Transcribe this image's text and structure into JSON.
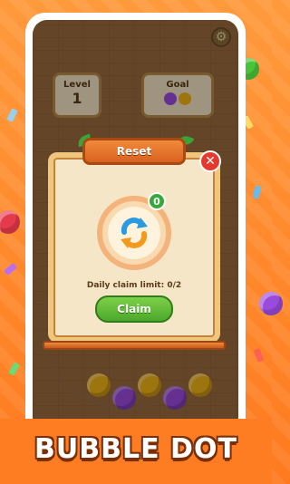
{
  "hud": {
    "level_label": "Level",
    "level_value": "1",
    "goal_label": "Goal"
  },
  "modal": {
    "title": "Reset",
    "close_symbol": "✕",
    "badge_count": "0",
    "limit_text": "Daily claim limit: 0/2",
    "claim_label": "Claim",
    "icon": "refresh-arrows-icon"
  },
  "logo_text": "BUBBLE DOT",
  "colors": {
    "background": "#ff7d22",
    "banner": "#e8752a",
    "claim": "#5db534",
    "close": "#e5392e"
  },
  "bottom_badge": "0"
}
